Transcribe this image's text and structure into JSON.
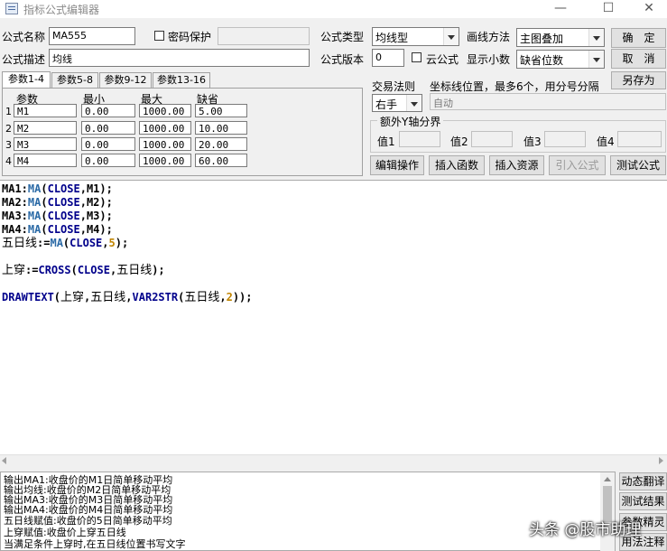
{
  "window": {
    "title": "指标公式编辑器",
    "minimize": "—",
    "maximize": "☐",
    "close": "✕"
  },
  "form": {
    "name_label": "公式名称",
    "name_value": "MA555",
    "password_label": "密码保护",
    "desc_label": "公式描述",
    "desc_value": "均线",
    "type_label": "公式类型",
    "type_value": "均线型",
    "draw_label": "画线方法",
    "draw_value": "主图叠加",
    "version_label": "公式版本",
    "version_value": "0",
    "cloud_label": "云公式",
    "decimal_label": "显示小数",
    "decimal_value": "缺省位数"
  },
  "buttons": {
    "ok": "确　定",
    "cancel": "取　消",
    "save_as": "另存为",
    "edit_op": "编辑操作",
    "insert_func": "插入函数",
    "insert_res": "插入资源",
    "import_formula": "引入公式",
    "test_formula": "测试公式"
  },
  "tabs": [
    "参数1-4",
    "参数5-8",
    "参数9-12",
    "参数13-16"
  ],
  "params": {
    "headers": [
      "参数",
      "最小",
      "最大",
      "缺省"
    ],
    "rows": [
      {
        "no": "1",
        "name": "M1",
        "min": "0.00",
        "max": "1000.00",
        "def": "5.00"
      },
      {
        "no": "2",
        "name": "M2",
        "min": "0.00",
        "max": "1000.00",
        "def": "10.00"
      },
      {
        "no": "3",
        "name": "M3",
        "min": "0.00",
        "max": "1000.00",
        "def": "20.00"
      },
      {
        "no": "4",
        "name": "M4",
        "min": "0.00",
        "max": "1000.00",
        "def": "60.00"
      }
    ]
  },
  "trade": {
    "label": "交易法则",
    "value": "右手",
    "coord_label": "坐标线位置，最多6个，用分号分隔",
    "coord_value": "自动"
  },
  "yaxis": {
    "title": "额外Y轴分界",
    "labels": [
      "值1",
      "值2",
      "值3",
      "值4"
    ]
  },
  "code": {
    "l1": {
      "a": "MA1:",
      "f": "MA",
      "b": "(",
      "k": "CLOSE",
      "c": ",M1);"
    },
    "l2": {
      "a": "MA2:",
      "f": "MA",
      "b": "(",
      "k": "CLOSE",
      "c": ",M2);"
    },
    "l3": {
      "a": "MA3:",
      "f": "MA",
      "b": "(",
      "k": "CLOSE",
      "c": ",M3);"
    },
    "l4": {
      "a": "MA4:",
      "f": "MA",
      "b": "(",
      "k": "CLOSE",
      "c": ",M4);"
    },
    "l5": {
      "var": "五日线",
      "op": ":=",
      "f": "MA",
      "b": "(",
      "k": "CLOSE",
      "c": ",",
      "n": "5",
      "d": ");"
    },
    "l6": {
      "var": "上穿",
      "op": ":=",
      "f": "CROSS",
      "b": "(",
      "k": "CLOSE",
      "c": ",",
      "v2": "五日线",
      "d": ");"
    },
    "l7": {
      "f": "DRAWTEXT",
      "b": "(",
      "v1": "上穿",
      "c1": ",",
      "v2": "五日线",
      "c2": ",",
      "f2": "VAR2STR",
      "b2": "(",
      "v3": "五日线",
      "c3": ",",
      "n": "2",
      "d": "));"
    }
  },
  "output_lines": [
    "输出MA1:收盘价的M1日简单移动平均",
    "输出均线:收盘价的M2日简单移动平均",
    "输出MA3:收盘价的M3日简单移动平均",
    "输出MA4:收盘价的M4日简单移动平均",
    "五日线赋值:收盘价的5日简单移动平均",
    "上穿赋值:收盘价上穿五日线",
    "当满足条件上穿时,在五日线位置书写文字"
  ],
  "side_buttons": [
    "动态翻译",
    "测试结果",
    "参数精灵",
    "用法注释"
  ],
  "watermark": "头条 @股市助理"
}
